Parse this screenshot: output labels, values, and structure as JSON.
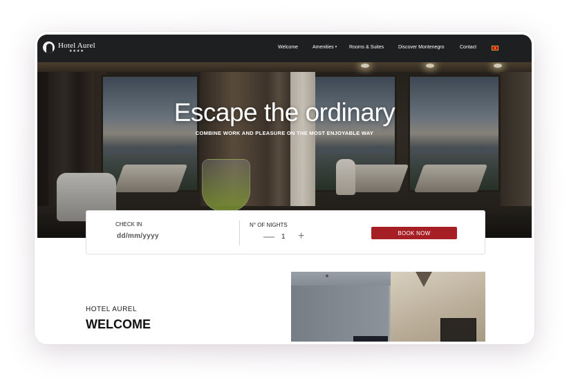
{
  "brand": {
    "name": "Hotel Aurel",
    "stars": "★★★★"
  },
  "nav": {
    "items": [
      {
        "label": "Welcome"
      },
      {
        "label": "Amenities"
      },
      {
        "label": "Rooms & Suites"
      },
      {
        "label": "Discover Montenegro"
      },
      {
        "label": "Contact"
      }
    ],
    "caret": "▾",
    "language_flag": "montenegro-flag-icon"
  },
  "hero": {
    "title": "Escape the ordinary",
    "subtitle": "COMBINE WORK AND PLEASURE ON THE MOST ENJOYABLE WAY"
  },
  "booking": {
    "checkin_label": "CHECK IN",
    "checkin_placeholder": "dd/mm/yyyy",
    "nights_label": "N° OF NIGHTS",
    "nights_value": "1",
    "minus": "—",
    "plus": "+",
    "book_label": "BOOK NOW"
  },
  "welcome": {
    "kicker": "HOTEL AUREL",
    "heading": "WELCOME"
  },
  "colors": {
    "nav_bg": "#1e1f21",
    "accent": "#a61f24",
    "text": "#111111"
  }
}
